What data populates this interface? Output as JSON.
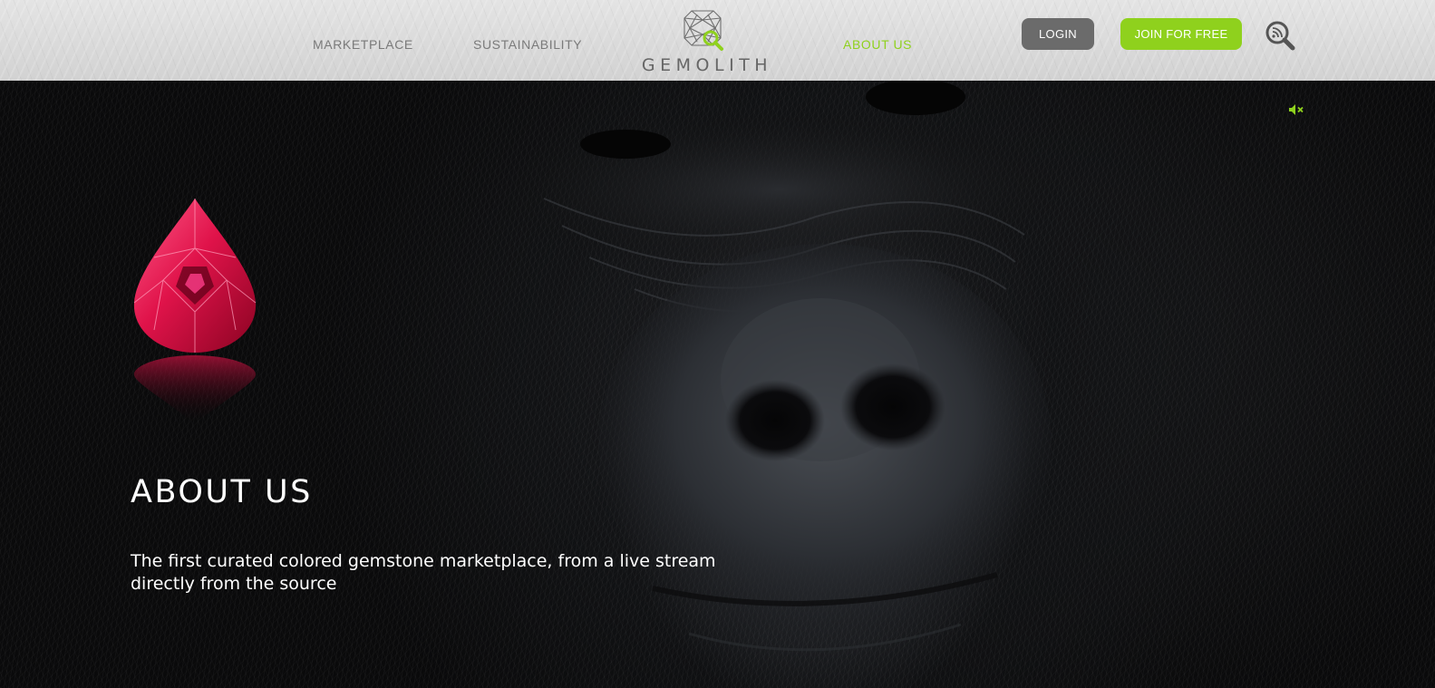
{
  "header": {
    "nav": [
      {
        "label": "MARKETPLACE"
      },
      {
        "label": "SUSTAINABILITY"
      },
      {
        "label": "ABOUT US"
      }
    ],
    "logo_text": "GEMOLITH",
    "login_label": "LOGIN",
    "join_label": "JOIN FOR FREE",
    "search_icon": "search-icon"
  },
  "hero": {
    "title": "ABOUT US",
    "subtitle": "The first curated colored gemstone marketplace, from a live stream directly from the source",
    "mute_icon": "speaker-muted-icon"
  },
  "colors": {
    "accent": "#8fd11d",
    "login_bg": "#6b6b6b",
    "nav_text": "#7a7a7a",
    "gem": "#e0134a"
  }
}
